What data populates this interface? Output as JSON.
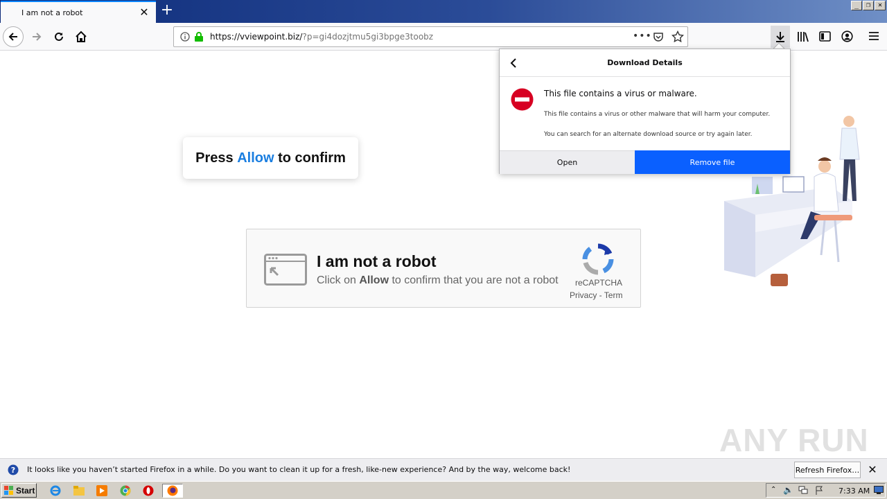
{
  "browser": {
    "tab_title": "I am not a robot",
    "url_host": "https://vviewpoint.biz/",
    "url_path": "?p=gi4dozjtmu5gi3bpge3toobz"
  },
  "page": {
    "press_prefix": "Press",
    "press_allow": "Allow",
    "press_suffix": "to confirm",
    "captcha_title": "I am not a robot",
    "captcha_sub_prefix": "Click on",
    "captcha_sub_allow": "Allow",
    "captcha_sub_suffix": "to confirm that you are not a robot",
    "recaptcha_label": "reCAPTCHA",
    "recaptcha_links": "Privacy - Term"
  },
  "download_panel": {
    "title": "Download Details",
    "message_main": "This file contains a virus or malware.",
    "message_detail_1": "This file contains a virus or other malware that will harm your computer.",
    "message_detail_2": "You can search for an alternate download source or try again later.",
    "open_label": "Open",
    "remove_label": "Remove file"
  },
  "notification": {
    "text": "It looks like you haven’t started Firefox in a while. Do you want to clean it up for a fresh, like-new experience? And by the way, welcome back!",
    "refresh_label": "Refresh Firefox…"
  },
  "taskbar": {
    "start_label": "Start",
    "clock": "7:33 AM"
  },
  "watermark": "ANY RUN",
  "colors": {
    "accent_blue": "#0a60ff",
    "allow_blue": "#1a7ee0",
    "malware_red": "#d70022"
  }
}
